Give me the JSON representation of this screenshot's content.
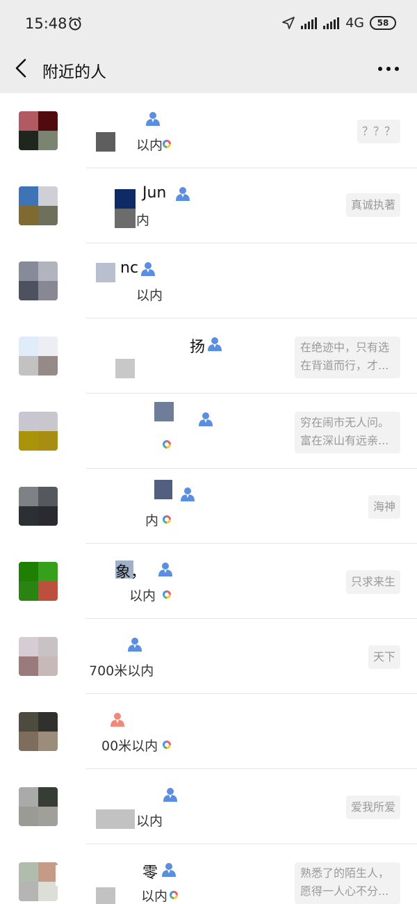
{
  "status": {
    "time": "15:48",
    "network": "4G",
    "battery": "58"
  },
  "nav": {
    "title": "附近的人"
  },
  "icons": {
    "back": "chevron-left-icon",
    "more": "more-dots-icon",
    "alarm": "alarm-clock-icon",
    "send": "location-arrow-icon",
    "signal": "signal-bars-icon",
    "male": "male-person-icon",
    "female": "female-person-icon",
    "moments": "moments-ring-icon"
  },
  "people": [
    {
      "name": "",
      "distance": "以内",
      "signature": "？？？",
      "gender": "male",
      "moments": true,
      "avatar": [
        "#b25a61",
        "#4f0b0e",
        "#1f261d",
        "#7b8470"
      ]
    },
    {
      "name": "Jun",
      "distance": "内",
      "signature": "真诚执著",
      "gender": "male",
      "moments": false,
      "avatar": [
        "#3e73b6",
        "#cfd0d5",
        "#7f6a31",
        "#6e705b"
      ]
    },
    {
      "name": "nc",
      "distance": "以内",
      "signature": "",
      "gender": "male",
      "moments": false,
      "avatar": [
        "#868a99",
        "#b2b4bd",
        "#4d5160",
        "#878894"
      ]
    },
    {
      "name": "扬",
      "distance": "",
      "signature": "在绝迹中，只有选在背道而行，才...",
      "gender": "male",
      "moments": false,
      "avatar": [
        "#e0ecf9",
        "#eceef4",
        "#c3c1c1",
        "#968a89"
      ]
    },
    {
      "name": "",
      "distance": "",
      "signature": "穷在闹市无人问。富在深山有远亲...",
      "gender": "male",
      "moments": true,
      "avatar": [
        "#c8c6d0",
        "#c9c7ce",
        "#a89309",
        "#a78e13"
      ]
    },
    {
      "name": "",
      "distance": "内",
      "signature": "海神",
      "gender": "male",
      "moments": true,
      "avatar": [
        "#7e8287",
        "#55585d",
        "#2c2f33",
        "#2a2b30"
      ]
    },
    {
      "name": "象，",
      "distance": "以内",
      "signature": "只求来生",
      "gender": "male",
      "moments": true,
      "avatar": [
        "#1f7f03",
        "#35a01c",
        "#2b8311",
        "#bd4f3e"
      ]
    },
    {
      "name": "",
      "distance": "700米以内",
      "signature": "天下",
      "gender": "male",
      "moments": false,
      "avatar": [
        "#d5cdd3",
        "#c9c2c4",
        "#9a7a7a",
        "#c7b9b7"
      ]
    },
    {
      "name": "",
      "distance": "00米以内",
      "signature": "",
      "gender": "female",
      "moments": true,
      "avatar": [
        "#4d4b40",
        "#30312d",
        "#7e6c5c",
        "#9b8c7c"
      ]
    },
    {
      "name": "",
      "distance": "以内",
      "signature": "爱我所爱",
      "gender": "male",
      "moments": false,
      "avatar": [
        "#a8aba7",
        "#363d35",
        "#9a9b95",
        "#a19f9a"
      ]
    },
    {
      "name": "零",
      "distance": "以内",
      "signature": "熟悉了的陌生人，愿得一人心不分...",
      "gender": "male",
      "moments": true,
      "avatar": [
        "#b1bdac",
        "#c59a86",
        "#b7b5b3",
        "#dcdfd7"
      ]
    }
  ]
}
